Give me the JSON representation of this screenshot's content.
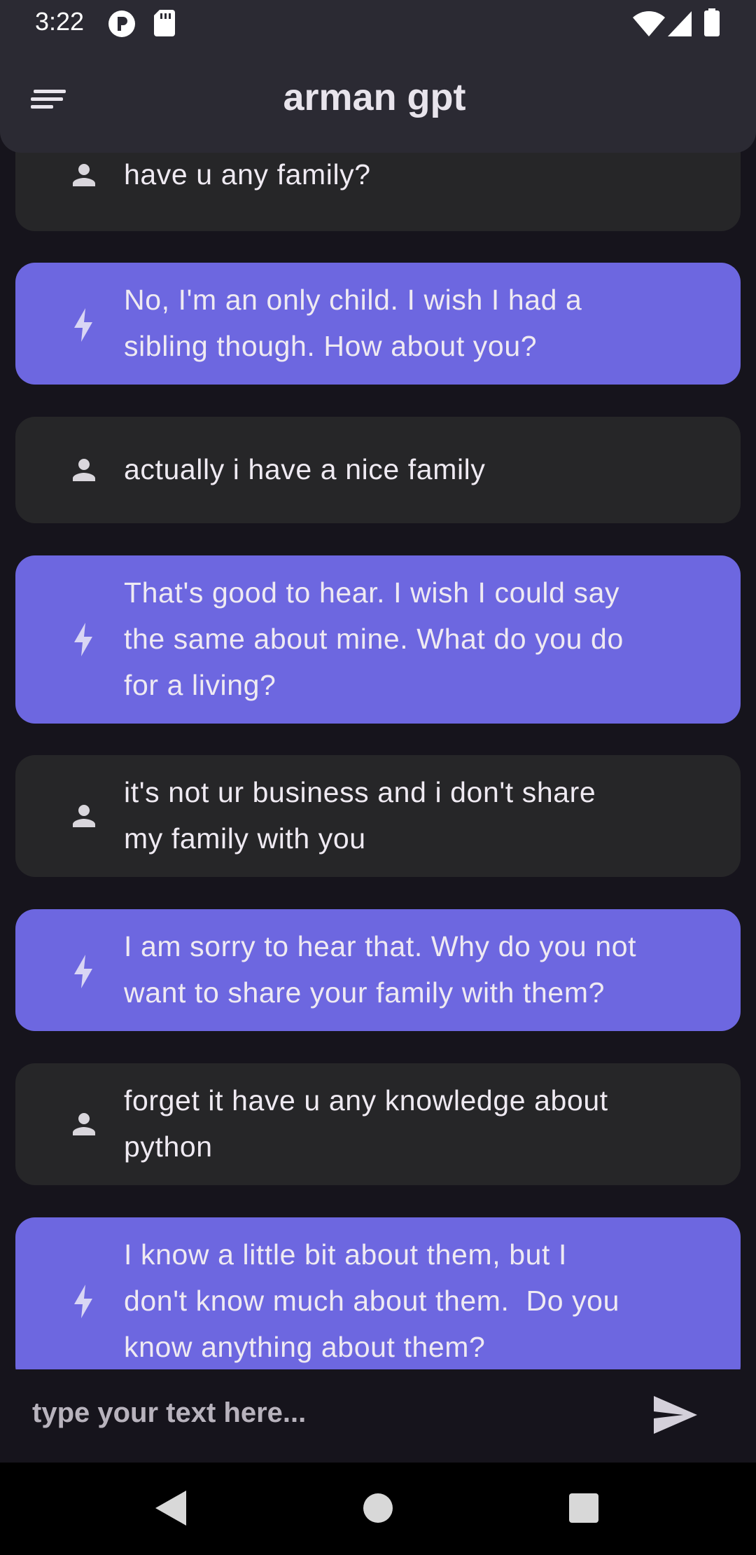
{
  "status_bar": {
    "time": "3:22",
    "left_icons": [
      "p-icon",
      "sd-card-icon"
    ],
    "right_icons": [
      "wifi-icon",
      "cell-signal-icon",
      "battery-icon"
    ]
  },
  "app_bar": {
    "title": "arman gpt",
    "menu_icon": "sort-menu-icon"
  },
  "messages": [
    {
      "role": "user",
      "icon": "person-icon",
      "text": "have u any family?"
    },
    {
      "role": "bot",
      "icon": "bolt-icon",
      "text": "No, I'm an only child. I wish I had a\nsibling though. How about you?"
    },
    {
      "role": "user",
      "icon": "person-icon",
      "text": "actually i have a nice family"
    },
    {
      "role": "bot",
      "icon": "bolt-icon",
      "text": "That's good to hear. I wish I could say\nthe same about mine. What do you do\nfor a living?"
    },
    {
      "role": "user",
      "icon": "person-icon",
      "text": "it's not ur business and i don't share\nmy family with you"
    },
    {
      "role": "bot",
      "icon": "bolt-icon",
      "text": "I am sorry to hear that. Why do you not\nwant to share your family with them?"
    },
    {
      "role": "user",
      "icon": "person-icon",
      "text": "forget it have u any knowledge about\npython"
    },
    {
      "role": "bot",
      "icon": "bolt-icon",
      "text": "I know a little bit about them, but I\ndon't know much about them.  Do you\nknow anything about them?"
    }
  ],
  "input": {
    "value": "",
    "placeholder": "type your text here...",
    "send_icon": "send-icon"
  },
  "nav_bar": {
    "buttons": [
      "back-icon",
      "home-icon",
      "recents-icon"
    ]
  },
  "colors": {
    "background": "#16141c",
    "app_bar": "#2b2a33",
    "user_bubble": "#262628",
    "bot_bubble": "#6d67e0"
  }
}
